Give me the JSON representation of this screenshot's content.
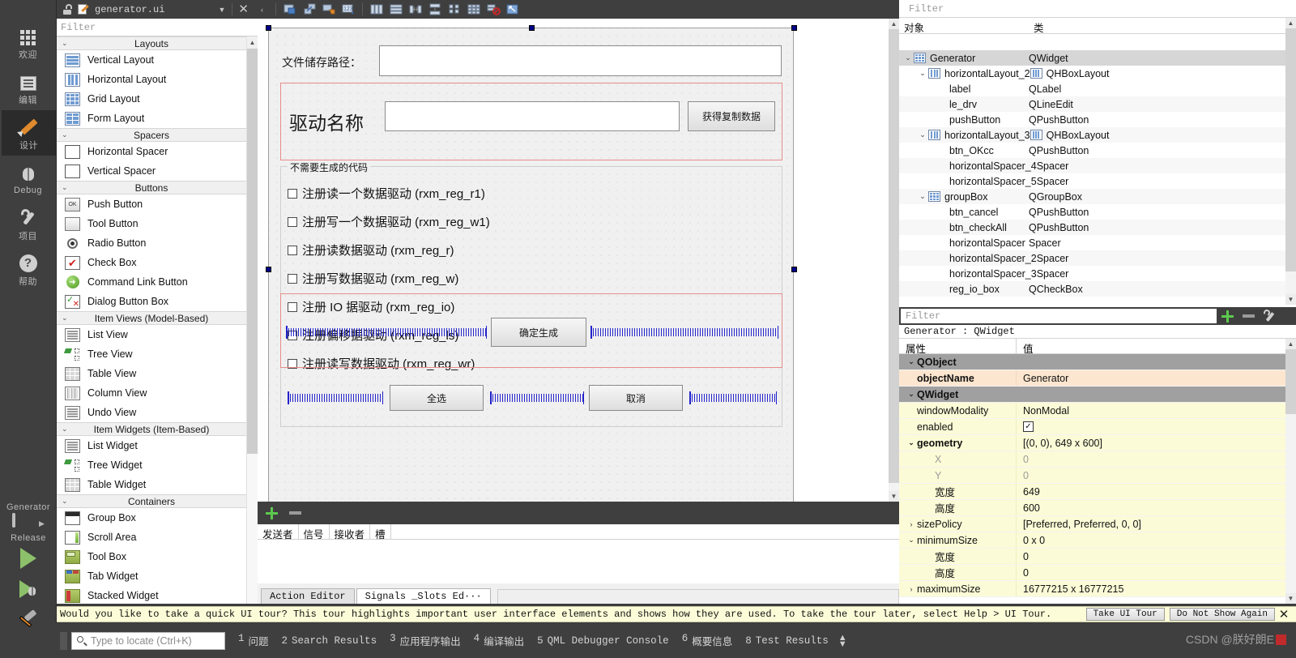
{
  "modebar": {
    "modes": [
      {
        "label": "欢迎",
        "icon": "welcome-grid-icon",
        "active": false
      },
      {
        "label": "编辑",
        "icon": "edit-document-icon",
        "active": false
      },
      {
        "label": "设计",
        "icon": "design-pencil-icon",
        "active": true
      },
      {
        "label": "Debug",
        "icon": "debug-bug-icon",
        "active": false
      },
      {
        "label": "项目",
        "icon": "projects-wrench-icon",
        "active": false
      },
      {
        "label": "帮助",
        "icon": "help-question-icon",
        "active": false
      }
    ],
    "kit": {
      "project_name": "Generator",
      "build_config": "Release",
      "monitor_icon": "target-selector-icon",
      "run_icon": "run-play-icon",
      "debug_icon": "debug-run-icon",
      "build_icon": "build-hammer-icon"
    }
  },
  "widgetbox": {
    "title": "generator.ui",
    "filter_placeholder": "Filter",
    "sections": [
      {
        "title": "Layouts",
        "items": [
          {
            "label": "Vertical Layout",
            "icon": "vertical-layout-icon"
          },
          {
            "label": "Horizontal Layout",
            "icon": "horizontal-layout-icon"
          },
          {
            "label": "Grid Layout",
            "icon": "grid-layout-icon"
          },
          {
            "label": "Form Layout",
            "icon": "form-layout-icon"
          }
        ]
      },
      {
        "title": "Spacers",
        "items": [
          {
            "label": "Horizontal Spacer",
            "icon": "horizontal-spacer-icon"
          },
          {
            "label": "Vertical Spacer",
            "icon": "vertical-spacer-icon"
          }
        ]
      },
      {
        "title": "Buttons",
        "items": [
          {
            "label": "Push Button",
            "icon": "push-button-icon"
          },
          {
            "label": "Tool Button",
            "icon": "tool-button-icon"
          },
          {
            "label": "Radio Button",
            "icon": "radio-button-icon"
          },
          {
            "label": "Check Box",
            "icon": "check-box-icon"
          },
          {
            "label": "Command Link Button",
            "icon": "command-link-icon"
          },
          {
            "label": "Dialog Button Box",
            "icon": "dialog-button-box-icon"
          }
        ]
      },
      {
        "title": "Item Views (Model-Based)",
        "items": [
          {
            "label": "List View",
            "icon": "list-view-icon"
          },
          {
            "label": "Tree View",
            "icon": "tree-view-icon"
          },
          {
            "label": "Table View",
            "icon": "table-view-icon"
          },
          {
            "label": "Column View",
            "icon": "column-view-icon"
          },
          {
            "label": "Undo View",
            "icon": "undo-view-icon"
          }
        ]
      },
      {
        "title": "Item Widgets (Item-Based)",
        "items": [
          {
            "label": "List Widget",
            "icon": "list-widget-icon"
          },
          {
            "label": "Tree Widget",
            "icon": "tree-widget-icon"
          },
          {
            "label": "Table Widget",
            "icon": "table-widget-icon"
          }
        ]
      },
      {
        "title": "Containers",
        "items": [
          {
            "label": "Group Box",
            "icon": "group-box-icon"
          },
          {
            "label": "Scroll Area",
            "icon": "scroll-area-icon"
          },
          {
            "label": "Tool Box",
            "icon": "tool-box-icon"
          },
          {
            "label": "Tab Widget",
            "icon": "tab-widget-icon"
          },
          {
            "label": "Stacked Widget",
            "icon": "stacked-widget-icon"
          }
        ]
      }
    ]
  },
  "form_toolbar": {
    "buttons": [
      {
        "icon": "edit-widgets-icon"
      },
      {
        "icon": "edit-signals-slots-icon"
      },
      {
        "icon": "edit-buddies-icon"
      },
      {
        "icon": "edit-tab-order-icon"
      },
      {
        "icon": "layout-horizontally-icon"
      },
      {
        "icon": "layout-vertically-icon"
      },
      {
        "icon": "layout-in-splitter-h-icon"
      },
      {
        "icon": "layout-in-splitter-v-icon"
      },
      {
        "icon": "layout-in-form-icon"
      },
      {
        "icon": "layout-in-grid-icon"
      },
      {
        "icon": "break-layout-icon"
      },
      {
        "icon": "adjust-size-icon"
      }
    ]
  },
  "form": {
    "geometry_label": "649 x 600",
    "path_label": "文件储存路径：",
    "path_value": "",
    "drv_label": "驱动名称",
    "drv_value": "",
    "copy_button": "获得复制数据",
    "groupbox_title": "不需要生成的代码",
    "checkboxes": [
      {
        "label": "注册读一个数据驱动 (rxm_reg_r1)",
        "checked": false
      },
      {
        "label": "注册写一个数据驱动 (rxm_reg_w1)",
        "checked": false
      },
      {
        "label": "注册读数据驱动 (rxm_reg_r)",
        "checked": false
      },
      {
        "label": "注册写数据驱动 (rxm_reg_w)",
        "checked": false
      },
      {
        "label": "注册 IO 据驱动 (rxm_reg_io)",
        "checked": false
      },
      {
        "label": "注册偏移据驱动 (rxm_reg_ls)",
        "checked": false
      },
      {
        "label": "注册读写数据驱动 (rxm_reg_wr)",
        "checked": false
      }
    ],
    "select_all_button": "全选",
    "cancel_button": "取消",
    "generate_button": "确定生成"
  },
  "signal_slot": {
    "add_icon": "add-connection-icon",
    "remove_icon": "remove-connection-icon",
    "columns": [
      "发送者",
      "信号",
      "接收者",
      "槽"
    ],
    "rows": [],
    "tabs": [
      {
        "label": "Action Editor",
        "active": false
      },
      {
        "label": "Signals _Slots Ed···",
        "active": true
      }
    ]
  },
  "object_inspector": {
    "filter_placeholder": "Filter",
    "columns": [
      "对象",
      "类"
    ],
    "rows": [
      {
        "name": "Generator",
        "class": "QWidget",
        "indent": 0,
        "chev": "v",
        "icon": "grid",
        "selected": true
      },
      {
        "name": "horizontalLayout_2",
        "class": "QHBoxLayout",
        "indent": 1,
        "chev": "v",
        "icon": "hbox",
        "class_icon": "hbox",
        "selected": false
      },
      {
        "name": "label",
        "class": "QLabel",
        "indent": 2,
        "chev": "",
        "icon": "",
        "selected": false
      },
      {
        "name": "le_drv",
        "class": "QLineEdit",
        "indent": 2,
        "chev": "",
        "icon": "",
        "selected": false
      },
      {
        "name": "pushButton",
        "class": "QPushButton",
        "indent": 2,
        "chev": "",
        "icon": "",
        "selected": false
      },
      {
        "name": "horizontalLayout_3",
        "class": "QHBoxLayout",
        "indent": 1,
        "chev": "v",
        "icon": "hbox",
        "class_icon": "hbox",
        "selected": false
      },
      {
        "name": "btn_OKcc",
        "class": "QPushButton",
        "indent": 2,
        "chev": "",
        "icon": "",
        "selected": false
      },
      {
        "name": "horizontalSpacer_4",
        "class": "Spacer",
        "indent": 2,
        "chev": "",
        "icon": "",
        "selected": false
      },
      {
        "name": "horizontalSpacer_5",
        "class": "Spacer",
        "indent": 2,
        "chev": "",
        "icon": "",
        "selected": false
      },
      {
        "name": "groupBox",
        "class": "QGroupBox",
        "indent": 1,
        "chev": "v",
        "icon": "grid",
        "selected": false
      },
      {
        "name": "btn_cancel",
        "class": "QPushButton",
        "indent": 2,
        "chev": "",
        "icon": "",
        "selected": false
      },
      {
        "name": "btn_checkAll",
        "class": "QPushButton",
        "indent": 2,
        "chev": "",
        "icon": "",
        "selected": false
      },
      {
        "name": "horizontalSpacer",
        "class": "Spacer",
        "indent": 2,
        "chev": "",
        "icon": "",
        "selected": false
      },
      {
        "name": "horizontalSpacer_2",
        "class": "Spacer",
        "indent": 2,
        "chev": "",
        "icon": "",
        "selected": false
      },
      {
        "name": "horizontalSpacer_3",
        "class": "Spacer",
        "indent": 2,
        "chev": "",
        "icon": "",
        "selected": false
      },
      {
        "name": "reg_io_box",
        "class": "QCheckBox",
        "indent": 2,
        "chev": "",
        "icon": "",
        "selected": false
      }
    ]
  },
  "property_editor": {
    "filter_placeholder": "Filter",
    "add_icon": "add-property-icon",
    "remove_icon": "remove-property-icon",
    "config_icon": "configure-icon",
    "object_header": "Generator : QWidget",
    "columns": [
      "属性",
      "值"
    ],
    "rows": [
      {
        "name": "QObject",
        "value": "",
        "kind": "group",
        "chev": "v"
      },
      {
        "name": "objectName",
        "value": "Generator",
        "kind": "peach",
        "chev": ""
      },
      {
        "name": "QWidget",
        "value": "",
        "kind": "group",
        "chev": "v"
      },
      {
        "name": "windowModality",
        "value": "NonModal",
        "kind": "yellow",
        "chev": ""
      },
      {
        "name": "enabled",
        "value": "",
        "kind": "yellow",
        "chev": "",
        "widget": "checkbox",
        "checked": true
      },
      {
        "name": "geometry",
        "value": "[(0, 0), 649 x 600]",
        "kind": "yellow",
        "chev": "v",
        "bold": true
      },
      {
        "name": "X",
        "value": "0",
        "kind": "yellow",
        "chev": "",
        "sub": true,
        "dim": true
      },
      {
        "name": "Y",
        "value": "0",
        "kind": "yellow",
        "chev": "",
        "sub": true,
        "dim": true
      },
      {
        "name": "宽度",
        "value": "649",
        "kind": "yellow",
        "chev": "",
        "sub": true
      },
      {
        "name": "高度",
        "value": "600",
        "kind": "yellow",
        "chev": "",
        "sub": true
      },
      {
        "name": "sizePolicy",
        "value": "[Preferred, Preferred, 0, 0]",
        "kind": "yellow",
        "chev": ">"
      },
      {
        "name": "minimumSize",
        "value": "0 x 0",
        "kind": "yellow",
        "chev": "v"
      },
      {
        "name": "宽度",
        "value": "0",
        "kind": "yellow",
        "chev": "",
        "sub": true
      },
      {
        "name": "高度",
        "value": "0",
        "kind": "yellow",
        "chev": "",
        "sub": true
      },
      {
        "name": "maximumSize",
        "value": "16777215 x 16777215",
        "kind": "yellow",
        "chev": ">"
      }
    ]
  },
  "tour": {
    "message": "Would you like to take a quick UI tour? This tour highlights important user interface elements and shows how they are used. To take the tour later, select Help > UI Tour.",
    "take_button": "Take UI Tour",
    "dismiss_button": "Do Not Show Again",
    "close_icon": "close-icon"
  },
  "statusbar": {
    "locate_placeholder": "Type to locate (Ctrl+K)",
    "search_icon": "search-icon",
    "panes": [
      {
        "num": "1",
        "label": "问题"
      },
      {
        "num": "2",
        "label": "Search Results"
      },
      {
        "num": "3",
        "label": "应用程序输出"
      },
      {
        "num": "4",
        "label": "编译输出"
      },
      {
        "num": "5",
        "label": "QML Debugger Console"
      },
      {
        "num": "6",
        "label": "概要信息"
      },
      {
        "num": "8",
        "label": "Test Results"
      }
    ],
    "watermark": "CSDN @朕好朗E"
  },
  "colors": {
    "dark_chrome": "#3f3f3f",
    "selection_red": "#e78b8b",
    "handle_blue": "#00008b",
    "spacer_blue": "#2222cc",
    "property_yellow": "#fcfbd7",
    "property_peach": "#fce6cf",
    "tour_yellow": "#fdfcd8",
    "green_accent": "#5cc94e"
  }
}
